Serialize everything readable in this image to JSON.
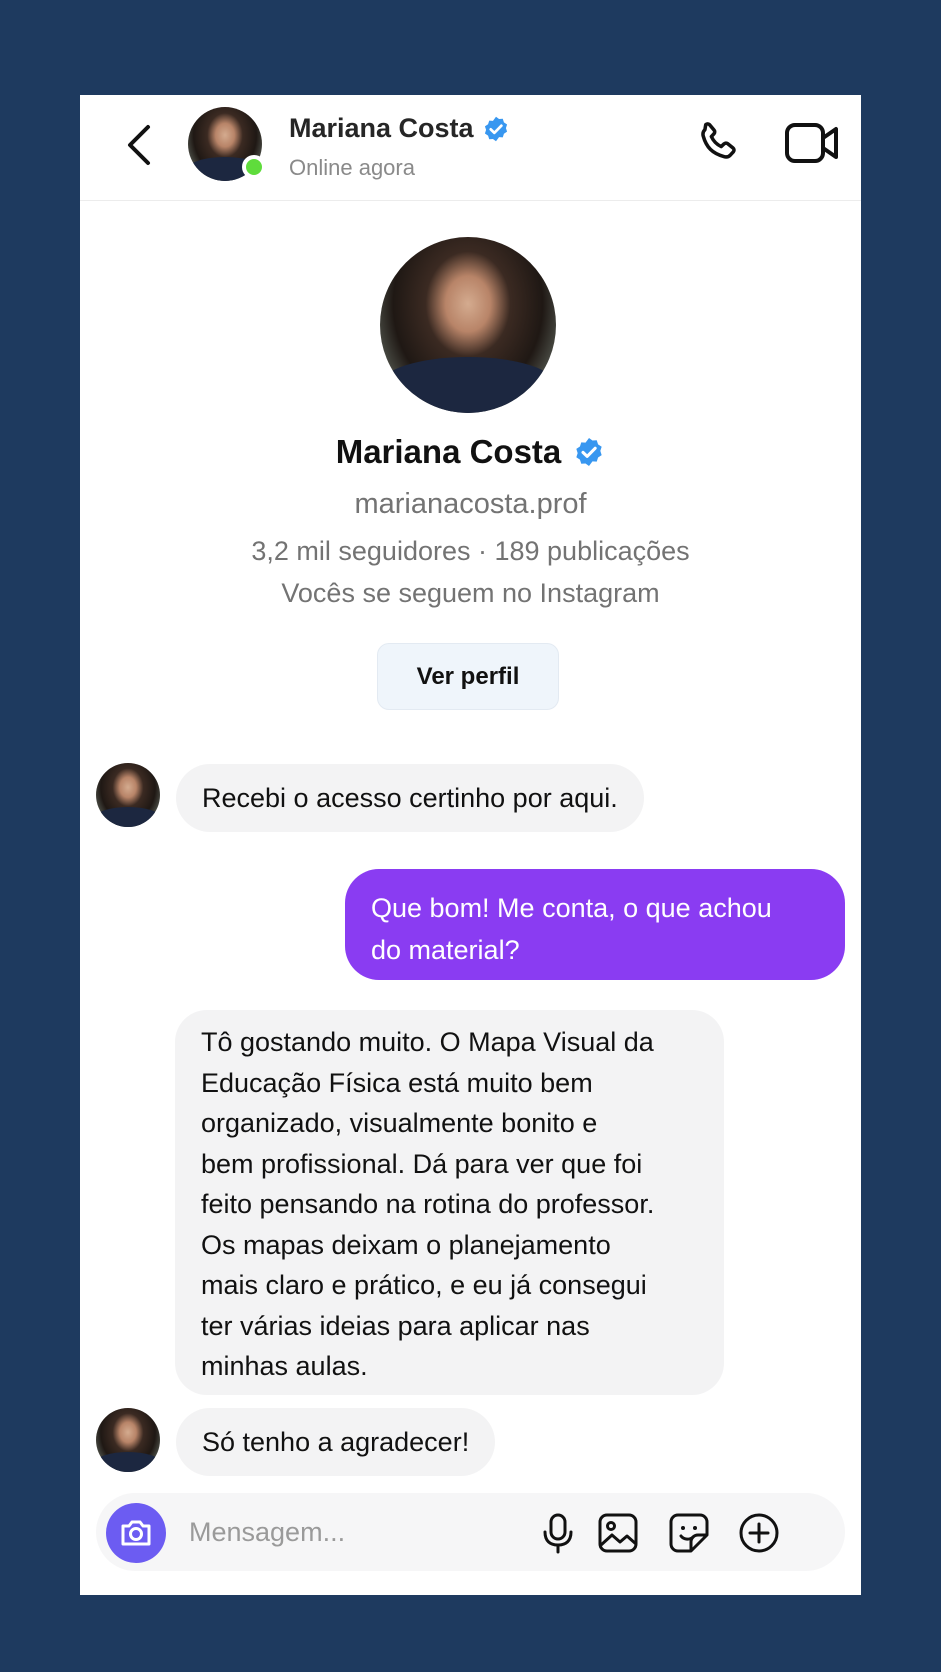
{
  "header": {
    "contact_name": "Mariana Costa",
    "status": "Online agora"
  },
  "profile": {
    "name": "Mariana Costa",
    "handle": "marianacosta.prof",
    "stats": "3,2 mil seguidores · 189 publicações",
    "mutual": "Vocês se seguem no Instagram",
    "view_button": "Ver perfil"
  },
  "messages": [
    {
      "from": "contact",
      "text": "Recebi o acesso certinho por aqui."
    },
    {
      "from": "me",
      "lines": [
        "Que bom! Me conta, o que achou",
        "do material?"
      ]
    },
    {
      "from": "contact",
      "lines": [
        "Tô gostando muito. O Mapa Visual da",
        "Educação Física está muito bem",
        "organizado, visualmente bonito e",
        "bem profissional. Dá para ver que foi",
        "feito pensando na rotina do professor.",
        "Os mapas deixam o planejamento",
        "mais claro e prático, e eu já consegui",
        "ter várias ideias para aplicar nas",
        "minhas aulas."
      ]
    },
    {
      "from": "contact",
      "text": "Só tenho a agradecer!"
    }
  ],
  "composer": {
    "placeholder": "Mensagem..."
  },
  "colors": {
    "background": "#1e3a5f",
    "outgoing_bubble": "#8a3cf2",
    "incoming_bubble": "#f3f3f4",
    "verified": "#3897f0",
    "online": "#5fdc3c",
    "camera_button": "#6c5cf2"
  },
  "icons": {
    "back": "chevron-left-icon",
    "call": "phone-icon",
    "video": "video-camera-icon",
    "verified": "verified-badge-icon",
    "camera": "camera-icon",
    "mic": "microphone-icon",
    "gallery": "image-icon",
    "sticker": "sticker-icon",
    "add": "plus-circle-icon"
  }
}
